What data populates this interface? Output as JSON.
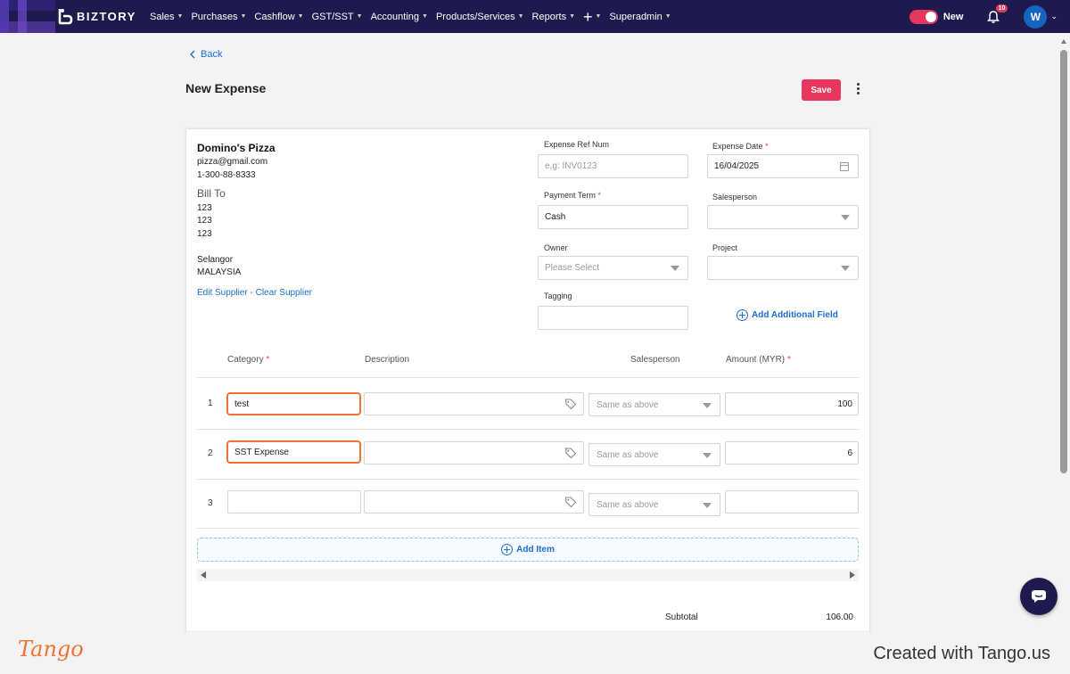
{
  "nav": {
    "brand": "BIZTORY",
    "menu": [
      "Sales",
      "Purchases",
      "Cashflow",
      "GST/SST",
      "Accounting",
      "Products/Services",
      "Reports",
      "+",
      "Superadmin"
    ],
    "new_label": "New",
    "notification_count": "10",
    "avatar_initial": "W",
    "toggle_on": true,
    "accent_color": "#e8375c",
    "bar_color": "#1e1a4d"
  },
  "header": {
    "back_label": "Back",
    "title": "New Expense",
    "save_label": "Save"
  },
  "supplier": {
    "name": "Domino's Pizza",
    "email": "pizza@gmail.com",
    "phone": "1-300-88-8333",
    "bill_to_label": "Bill To",
    "address": [
      "123",
      "123",
      "123",
      "",
      "Selangor",
      "MALAYSIA"
    ],
    "edit_link": "Edit Supplier",
    "separator": " - ",
    "clear_link": "Clear Supplier"
  },
  "form": {
    "ref_num": {
      "label": "Expense Ref Num",
      "placeholder": "e.g: INV0123",
      "value": ""
    },
    "date": {
      "label": "Expense Date",
      "value": "16/04/2025"
    },
    "payment_term": {
      "label": "Payment Term",
      "value": "Cash"
    },
    "salesperson": {
      "label": "Salesperson",
      "value": ""
    },
    "owner": {
      "label": "Owner",
      "placeholder": "Please Select"
    },
    "project": {
      "label": "Project",
      "value": ""
    },
    "tagging": {
      "label": "Tagging",
      "value": ""
    },
    "add_field_label": "Add Additional Field",
    "required_mark": "*"
  },
  "items": {
    "headers": {
      "category": "Category",
      "description": "Description",
      "salesperson": "Salesperson",
      "amount": "Amount (MYR)"
    },
    "rows": [
      {
        "num": "1",
        "category": "test",
        "description": "",
        "salesperson": "Same as above",
        "amount": "100"
      },
      {
        "num": "2",
        "category": "SST Expense",
        "description": "",
        "salesperson": "Same as above",
        "amount": "6"
      },
      {
        "num": "3",
        "category": "",
        "description": "",
        "salesperson": "Same as above",
        "amount": ""
      }
    ],
    "add_item_label": "Add Item",
    "highlight_color": "#f07431"
  },
  "totals": {
    "subtotal_label": "Subtotal",
    "subtotal_value": "106.00"
  },
  "footer": {
    "tango_logo": "Tango",
    "credit": "Created with Tango.us"
  }
}
